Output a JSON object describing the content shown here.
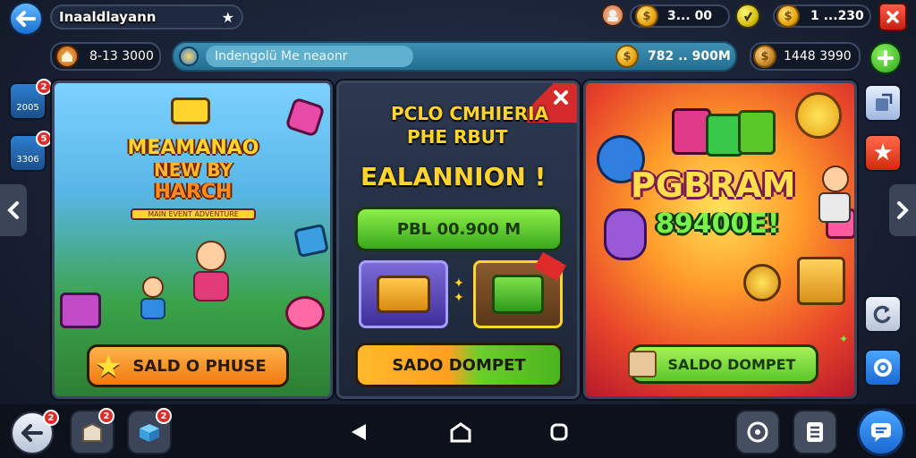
{
  "topbar": {
    "title": "Inaaldlayann",
    "star_icon": "star-icon",
    "avatar_icon": "avatar-icon",
    "coins_value": "3... 00",
    "premium_icon": "gem-icon",
    "gold_value": "1 ...230",
    "close_icon": "close-icon"
  },
  "secondbar": {
    "home_value": "8-13 3000",
    "notice_text": "Indengolü Me neaonr",
    "coins_value": "782 .. 900M",
    "purse_value": "1448 3990",
    "add_icon": "plus-icon"
  },
  "left_side": {
    "items": [
      {
        "label": "2005",
        "badge": "2"
      },
      {
        "label": "3306",
        "badge": "5"
      }
    ]
  },
  "panels": {
    "left": {
      "title_line1": "MEAMANAO",
      "title_line2": "NEW BY",
      "title_line3": "HARCH",
      "subtitle": "MAIN EVENT ADVENTURE",
      "button": "SALD O PHUSE"
    },
    "center": {
      "heading1": "PCLO CMHIERIA",
      "heading2": "PHE RBUT",
      "heading3": "EALANNION !",
      "green_button": "PBL 00.900 M",
      "reward_button": "SADO DOMPET"
    },
    "right": {
      "title": "PGBRAM",
      "subtitle": "89400E!",
      "button": "SALDO DOMPET"
    }
  },
  "right_side": {
    "buttons": [
      "share-icon",
      "star-icon",
      "refresh-icon",
      "settings-icon"
    ]
  },
  "bottom": {
    "left_badges": [
      "2",
      "2",
      "2"
    ],
    "nav": [
      "back-triangle-icon",
      "home-icon",
      "recents-icon"
    ],
    "right_buttons": [
      "help-icon",
      "list-icon",
      "chat-icon"
    ]
  },
  "colors": {
    "accent_green": "#6ccf2a",
    "accent_orange": "#ff9a1f",
    "accent_blue": "#2b8ad8",
    "badge_red": "#e02b2b"
  }
}
